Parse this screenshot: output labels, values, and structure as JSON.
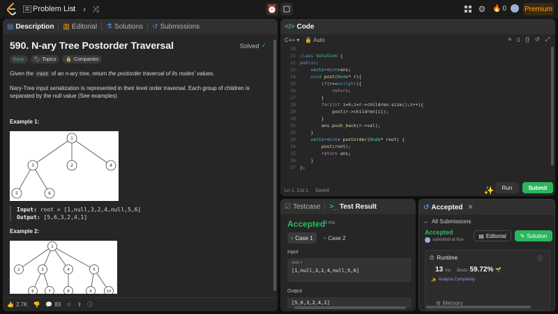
{
  "nav": {
    "problem_list": "Problem List",
    "streak_count": "0",
    "premium": "Premium"
  },
  "description": {
    "tabs": [
      {
        "label": "Description"
      },
      {
        "label": "Editorial"
      },
      {
        "label": "Solutions"
      },
      {
        "label": "Submissions"
      }
    ],
    "title": "590. N-ary Tree Postorder Traversal",
    "status": "Solved",
    "chips": {
      "difficulty": "Easy",
      "topics": "Topics",
      "companies": "Companies"
    },
    "para1_a": "Given the ",
    "para1_code": "root",
    "para1_b": " of an n-ary tree, return ",
    "para1_c": "the postorder traversal of its nodes' values",
    "para1_d": ".",
    "para2": "Nary-Tree input serialization is represented in their level order traversal. Each group of children is separated by the null value (See examples)",
    "example1_title": "Example 1:",
    "example1_input_label": "Input:",
    "example1_input": " root = [1,null,3,2,4,null,5,6]",
    "example1_output_label": "Output:",
    "example1_output": " [5,6,3,2,4,1]",
    "example2_title": "Example 2:",
    "tree1_nodes": [
      "1",
      "3",
      "2",
      "4",
      "5",
      "6"
    ],
    "tree2_nodes": [
      "1",
      "2",
      "3",
      "4",
      "5",
      "6",
      "7",
      "8",
      "9",
      "10"
    ],
    "likes": "2.7K",
    "comments": "83"
  },
  "code": {
    "tab": "Code",
    "language": "C++",
    "mode": "Auto",
    "lines": [
      {
        "n": "20",
        "t": ""
      },
      {
        "n": "21",
        "t": "class Solution {"
      },
      {
        "n": "22",
        "t": "public:"
      },
      {
        "n": "23",
        "t": "    vector<int>ans;"
      },
      {
        "n": "24",
        "t": "    void post(Node* r){"
      },
      {
        "n": "25",
        "t": "        if(r==nullptr){"
      },
      {
        "n": "26",
        "t": "            return;"
      },
      {
        "n": "27",
        "t": "        }"
      },
      {
        "n": "28",
        "t": "        for(int i=0;i<r->children.size();i++){"
      },
      {
        "n": "29",
        "t": "            post(r->children[i]);"
      },
      {
        "n": "30",
        "t": "        }"
      },
      {
        "n": "31",
        "t": "        ans.push_back(r->val);"
      },
      {
        "n": "32",
        "t": "    }"
      },
      {
        "n": "33",
        "t": "    vector<int> postorder(Node* root) {"
      },
      {
        "n": "34",
        "t": "        post(root);"
      },
      {
        "n": "35",
        "t": "        return ans;"
      },
      {
        "n": "36",
        "t": "    }"
      },
      {
        "n": "37",
        "t": "};"
      }
    ],
    "cursor": "Ln 1, Col 1",
    "saved": "Saved",
    "run": "Run",
    "submit": "Submit"
  },
  "testcase": {
    "tab1": "Testcase",
    "tab2": "Test Result",
    "status": "Accepted",
    "time": "3 ms",
    "case1": "Case 1",
    "case2": "Case 2",
    "input_label": "Input",
    "var_name": "root =",
    "input_value": "[1,null,3,2,4,null,5,6]",
    "output_label": "Output",
    "output_value": "[5,6,3,2,4,1]"
  },
  "accepted": {
    "tab": "Accepted",
    "back": "All Submissions",
    "status": "Accepted",
    "submitted": "submitted at Nov",
    "editorial": "Editorial",
    "solution": "Solution",
    "runtime_label": "Runtime",
    "runtime_value": "13",
    "runtime_unit": "ms",
    "beats_label": "Beats",
    "beats_value": "59.72%",
    "analyze": "Analyze Complexity",
    "memory_label": "Memory"
  },
  "colors": {
    "accent_green": "#2cbb5d",
    "premium_orange": "#ffa116",
    "submit_green": "#2db55d"
  }
}
